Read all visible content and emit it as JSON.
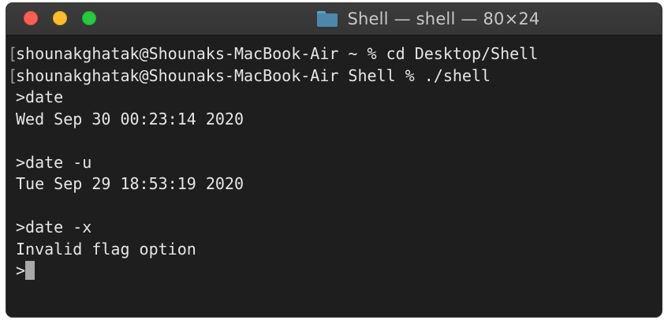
{
  "window": {
    "title": "Shell — shell — 80×24"
  },
  "terminal": {
    "lines": [
      {
        "mark": "[",
        "text": "shounakghatak@Shounaks-MacBook-Air ~ % cd Desktop/Shell"
      },
      {
        "mark": "[",
        "text": "shounakghatak@Shounaks-MacBook-Air Shell % ./shell"
      },
      {
        "mark": "",
        "text": ">date"
      },
      {
        "mark": "",
        "text": "Wed Sep 30 00:23:14 2020"
      },
      {
        "mark": "",
        "text": ""
      },
      {
        "mark": "",
        "text": ">date -u"
      },
      {
        "mark": "",
        "text": "Tue Sep 29 18:53:19 2020"
      },
      {
        "mark": "",
        "text": ""
      },
      {
        "mark": "",
        "text": ">date -x"
      },
      {
        "mark": "",
        "text": "Invalid flag option"
      }
    ],
    "prompt": ">"
  },
  "colors": {
    "background": "#1e1e1e",
    "text": "#e6e6e6",
    "titlebar": "#383838",
    "close": "#ff5f57",
    "minimize": "#febc2e",
    "zoom": "#28c840"
  },
  "icons": {
    "title_icon": "folder-icon"
  }
}
